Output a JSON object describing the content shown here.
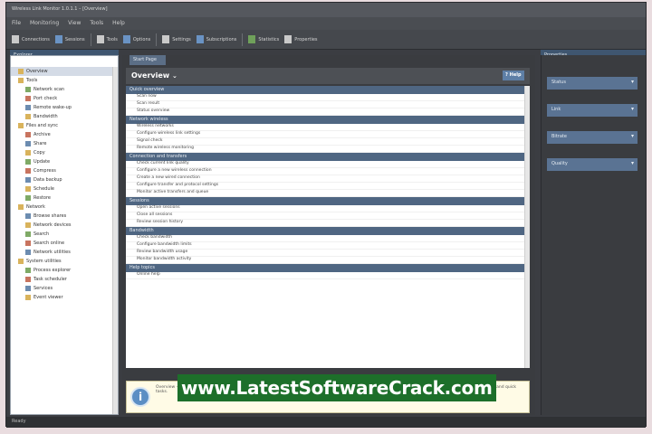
{
  "window": {
    "title": "Wireless Link Monitor 1.0.1.1 – [Overview]",
    "menu": [
      "File",
      "Monitoring",
      "View",
      "Tools",
      "Help"
    ]
  },
  "toolbar": {
    "buttons": [
      "Connections",
      "Sessions",
      "Tools",
      "Options",
      "Settings",
      "Subscriptions",
      "Statistics",
      "Properties"
    ]
  },
  "left_panel": {
    "title": "Explorer",
    "items": [
      {
        "label": "Overview",
        "level": 1,
        "selected": true
      },
      {
        "label": "Tools",
        "level": 1
      },
      {
        "label": "Network scan",
        "level": 2
      },
      {
        "label": "Port check",
        "level": 2
      },
      {
        "label": "Remote wake-up",
        "level": 2
      },
      {
        "label": "Bandwidth",
        "level": 2
      },
      {
        "label": "Files and sync",
        "level": 1
      },
      {
        "label": "Archive",
        "level": 2
      },
      {
        "label": "Share",
        "level": 2
      },
      {
        "label": "Copy",
        "level": 2
      },
      {
        "label": "Update",
        "level": 2
      },
      {
        "label": "Compress",
        "level": 2
      },
      {
        "label": "Data backup",
        "level": 2
      },
      {
        "label": "Schedule",
        "level": 2
      },
      {
        "label": "Restore",
        "level": 2
      },
      {
        "label": "Network",
        "level": 1
      },
      {
        "label": "Browse shares",
        "level": 2
      },
      {
        "label": "Network devices",
        "level": 2
      },
      {
        "label": "Search",
        "level": 2
      },
      {
        "label": "Search online",
        "level": 2
      },
      {
        "label": "Network utilities",
        "level": 2
      },
      {
        "label": "System utilities",
        "level": 1
      },
      {
        "label": "Process explorer",
        "level": 2
      },
      {
        "label": "Task scheduler",
        "level": 2
      },
      {
        "label": "Services",
        "level": 2
      },
      {
        "label": "Event viewer",
        "level": 2
      }
    ]
  },
  "center": {
    "doc_tab": "Start Page",
    "title": "Overview",
    "help": "Help",
    "sections": [
      {
        "title": "Quick overview",
        "rows": [
          "Scan now",
          "Scan result",
          "Status overview"
        ]
      },
      {
        "title": "Network wireless",
        "rows": [
          "Wireless networks",
          "Configure wireless link settings",
          "Signal check",
          "Remote wireless monitoring"
        ]
      },
      {
        "title": "Connection and transfers",
        "rows": [
          "Check current link quality",
          "Configure a new wireless connection",
          "Create a new wired connection",
          "Configure transfer and protocol settings",
          "Monitor active transfers and queue"
        ]
      },
      {
        "title": "Sessions",
        "rows": [
          "Open active sessions",
          "Close all sessions",
          "Review session history"
        ]
      },
      {
        "title": "Bandwidth",
        "rows": [
          "Check bandwidth",
          "Configure bandwidth limits",
          "Review bandwidth usage",
          "Monitor bandwidth activity"
        ]
      },
      {
        "title": "Help topics",
        "rows": [
          "Online help"
        ]
      }
    ],
    "info_text": "Overview — select an item from the list above to start a task, or use the tools on the left to run a network check. This page summarizes available monitoring features and quick tasks."
  },
  "watermark": "www.LatestSoftwareCrack.com",
  "right_panel": {
    "title": "Properties",
    "props": [
      "Status",
      "Link",
      "Bitrate",
      "Quality"
    ]
  },
  "status": "Ready"
}
